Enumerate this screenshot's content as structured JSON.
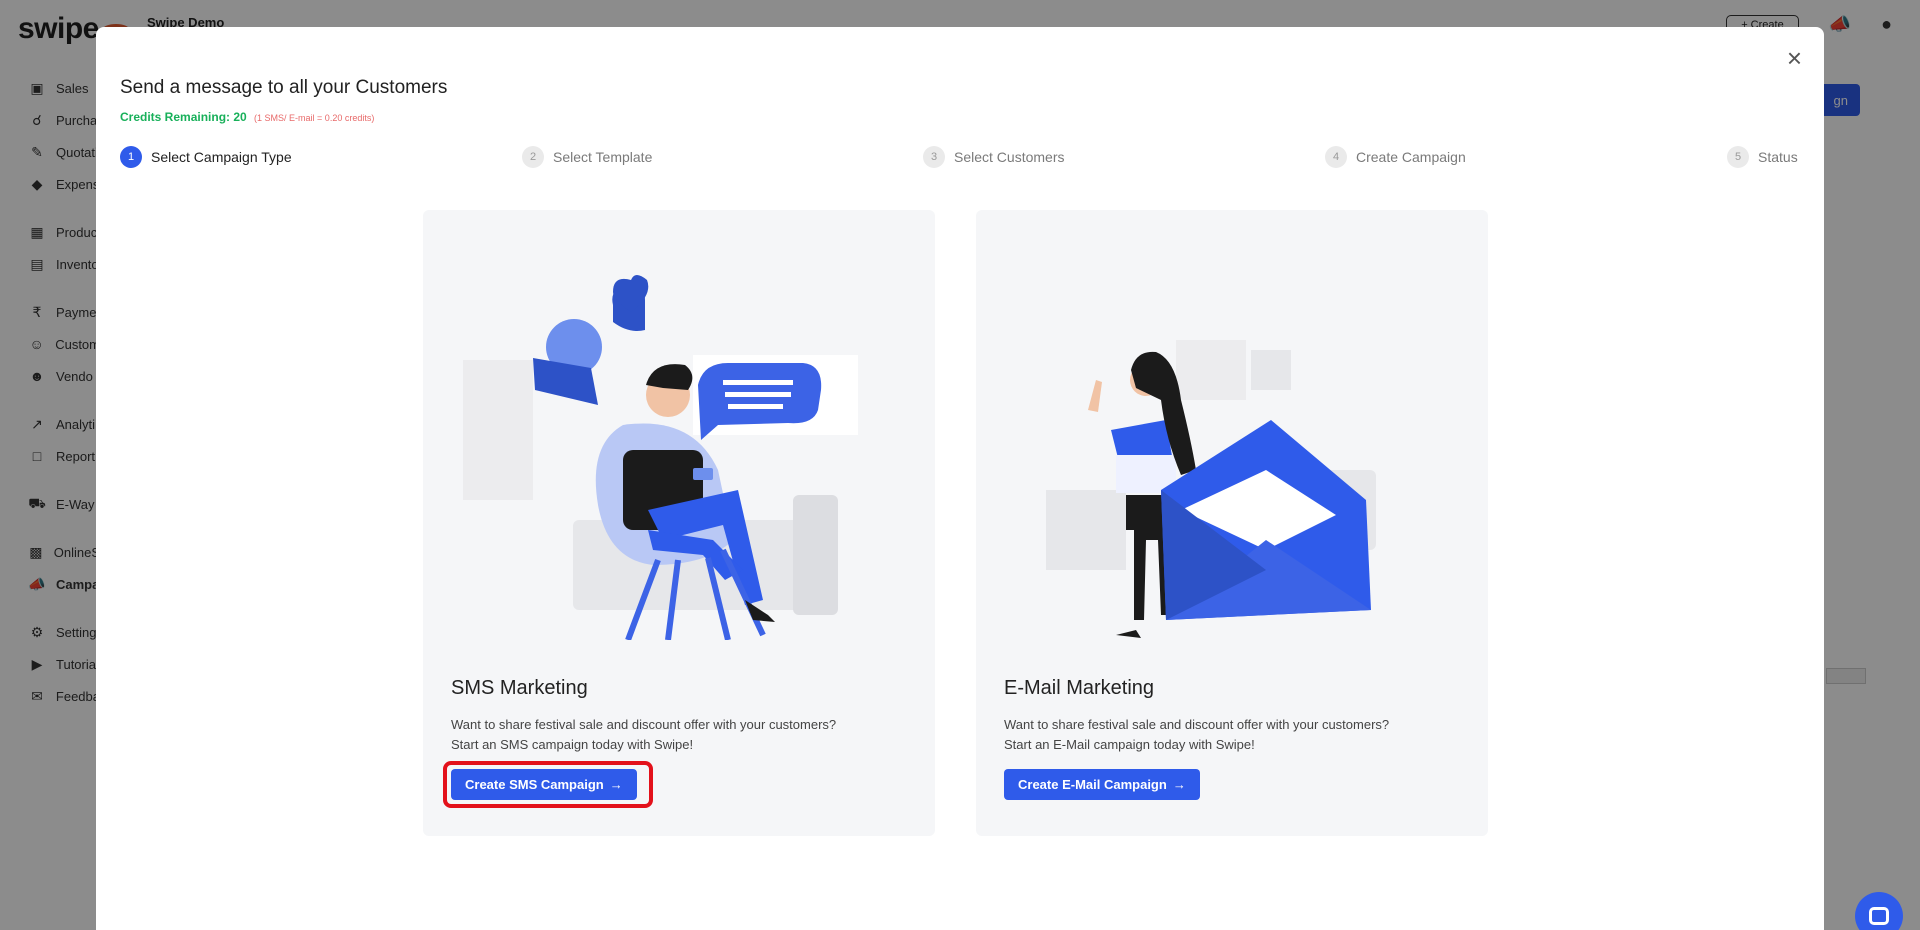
{
  "app": {
    "logo": "swipe",
    "company": "Swipe Demo",
    "create_label": "+ Create",
    "action_label": "gn",
    "brand_color": "#2f5bea"
  },
  "sidebar": {
    "items": [
      {
        "label": "Sales",
        "icon": "receipt-icon"
      },
      {
        "label": "Purcha",
        "icon": "cart-icon"
      },
      {
        "label": "Quotati",
        "icon": "pen-icon"
      },
      {
        "label": "Expens",
        "icon": "tag-icon"
      },
      {
        "label": "Produc",
        "icon": "box-icon"
      },
      {
        "label": "Invento",
        "icon": "warehouse-icon"
      },
      {
        "label": "Payme",
        "icon": "rupee-icon"
      },
      {
        "label": "Custom",
        "icon": "user-icon"
      },
      {
        "label": "Vendo",
        "icon": "users-icon"
      },
      {
        "label": "Analyti",
        "icon": "chart-icon"
      },
      {
        "label": "Report",
        "icon": "report-icon"
      },
      {
        "label": "E-Way",
        "icon": "truck-icon"
      },
      {
        "label": "OnlineS",
        "icon": "store-icon"
      },
      {
        "label": "Campa",
        "icon": "megaphone-icon"
      },
      {
        "label": "Setting",
        "icon": "gear-icon"
      },
      {
        "label": "Tutoria",
        "icon": "youtube-icon"
      },
      {
        "label": "Feedba",
        "icon": "feedback-icon"
      }
    ]
  },
  "modal": {
    "title": "Send a message to all your Customers",
    "credits_label": "Credits Remaining: 20",
    "credits_note": "(1 SMS/ E-mail = 0.20 credits)",
    "close": "×"
  },
  "steps": [
    {
      "num": "1",
      "label": "Select Campaign Type"
    },
    {
      "num": "2",
      "label": "Select Template"
    },
    {
      "num": "3",
      "label": "Select Customers"
    },
    {
      "num": "4",
      "label": "Create Campaign"
    },
    {
      "num": "5",
      "label": "Status"
    }
  ],
  "cards": {
    "sms": {
      "title": "SMS Marketing",
      "desc_line1": "Want to share festival sale and discount offer with your customers?",
      "desc_line2": "Start an SMS campaign today with Swipe!",
      "button": "Create SMS Campaign",
      "arrow": "→"
    },
    "email": {
      "title": "E-Mail Marketing",
      "desc_line1": "Want to share festival sale and discount offer with your customers?",
      "desc_line2": "Start an E-Mail campaign today with Swipe!",
      "button": "Create E-Mail Campaign",
      "arrow": "→"
    }
  },
  "colors": {
    "primary": "#2f5bea",
    "credits_green": "#18b05a",
    "credits_note": "#e86a6a",
    "highlight": "#e3111b"
  }
}
